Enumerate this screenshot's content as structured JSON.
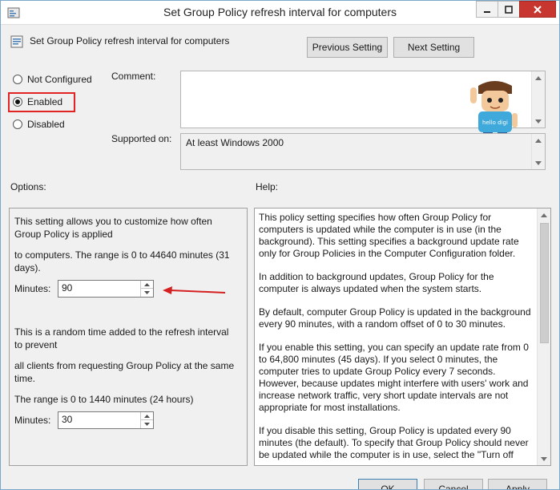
{
  "window": {
    "title": "Set Group Policy refresh interval for computers"
  },
  "header": {
    "policy_name": "Set Group Policy refresh interval for computers",
    "previous_setting": "Previous Setting",
    "next_setting": "Next Setting"
  },
  "state": {
    "options": [
      "Not Configured",
      "Enabled",
      "Disabled"
    ],
    "selected": "Enabled"
  },
  "comment": {
    "label": "Comment:",
    "value": ""
  },
  "supported": {
    "label": "Supported on:",
    "value": "At least Windows 2000"
  },
  "mascot": {
    "text": "hello digi"
  },
  "options": {
    "label": "Options:",
    "line1": "This setting allows you to customize how often Group Policy is applied",
    "line2": "to computers. The range is 0 to 44640 minutes (31 days).",
    "minutes1_label": "Minutes:",
    "minutes1_value": "90",
    "line3": "This is a random time added to the refresh interval to prevent",
    "line4": "all clients from requesting Group Policy at the same time.",
    "line5": "The range is 0 to 1440 minutes (24 hours)",
    "minutes2_label": "Minutes:",
    "minutes2_value": "30"
  },
  "help": {
    "label": "Help:",
    "paragraphs": [
      "This policy setting specifies how often Group Policy for computers is updated while the computer is in use (in the background). This setting specifies a background update rate only for Group Policies in the Computer Configuration folder.",
      "In addition to background updates, Group Policy for the computer is always updated when the system starts.",
      "By default, computer Group Policy is updated in the background every 90 minutes, with a random offset of 0 to 30 minutes.",
      "If you enable this setting, you can specify an update rate from 0 to 64,800 minutes (45 days). If you select 0 minutes, the computer tries to update Group Policy every 7 seconds. However, because updates might interfere with users' work and increase network traffic, very short update intervals are not appropriate for most installations.",
      "If you disable this setting, Group Policy is updated every 90 minutes (the default). To specify that Group Policy should never be updated while the computer is in use, select the \"Turn off"
    ]
  },
  "buttons": {
    "ok": "OK",
    "cancel": "Cancel",
    "apply": "Apply"
  },
  "colors": {
    "highlight": "#e02424",
    "arrow": "#d42020"
  }
}
